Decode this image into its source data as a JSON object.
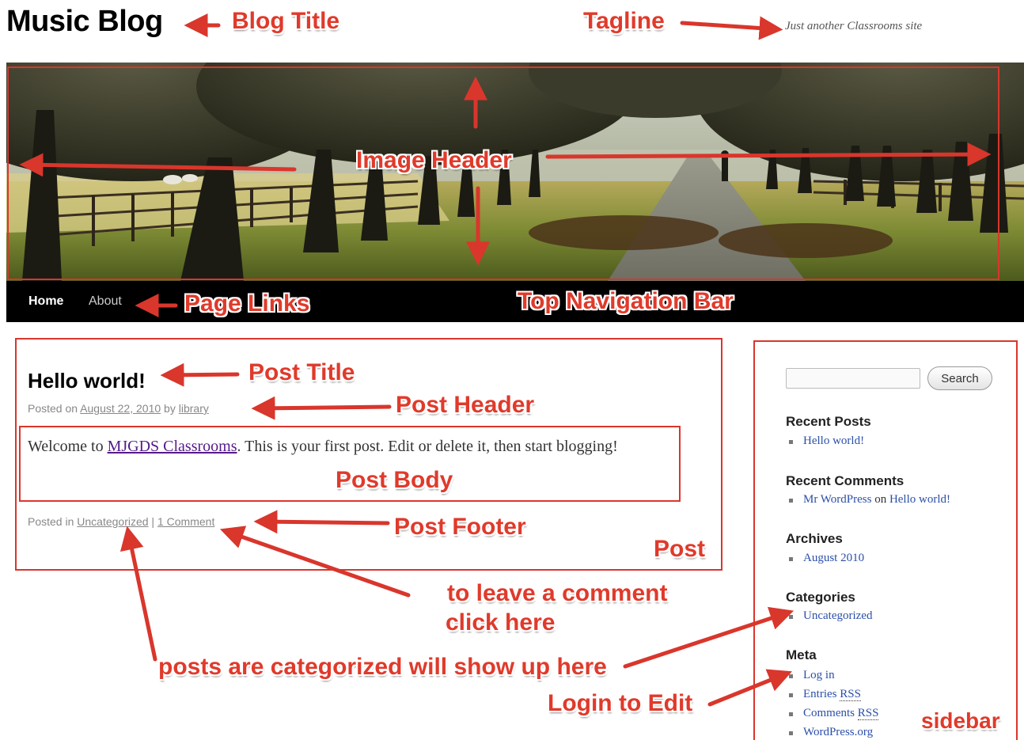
{
  "site": {
    "title": "Music Blog",
    "tagline": "Just another Classrooms site"
  },
  "nav": {
    "items": [
      {
        "label": "Home"
      },
      {
        "label": "About"
      }
    ]
  },
  "post": {
    "title": "Hello world!",
    "meta_prefix": "Posted on ",
    "date": "August 22, 2010",
    "meta_by": " by ",
    "author": "library",
    "body_prefix": "Welcome to ",
    "body_link": "MJGDS Classrooms",
    "body_suffix": ". This is your first post. Edit or delete it, then start blogging!",
    "footer_prefix": "Posted in ",
    "category": "Uncategorized",
    "footer_sep": " | ",
    "comments_link": "1 Comment"
  },
  "sidebar": {
    "search_placeholder": "",
    "search_button": "Search",
    "widgets": {
      "recent_posts": {
        "title": "Recent Posts",
        "items": [
          "Hello world!"
        ]
      },
      "recent_comments": {
        "title": "Recent Comments",
        "author": "Mr WordPress",
        "on": " on ",
        "post": "Hello world!"
      },
      "archives": {
        "title": "Archives",
        "items": [
          "August 2010"
        ]
      },
      "categories": {
        "title": "Categories",
        "items": [
          "Uncategorized"
        ]
      },
      "meta": {
        "title": "Meta",
        "login": "Log in",
        "entries_prefix": "Entries ",
        "comments_prefix": "Comments ",
        "rss": "RSS",
        "wordpress": "WordPress.org"
      }
    }
  },
  "annotations": {
    "blog_title": "Blog Title",
    "tagline": "Tagline",
    "image_header": "Image Header",
    "page_links": "Page Links",
    "top_nav_bar": "Top Navigation Bar",
    "post_title": "Post Title",
    "post_header": "Post Header",
    "post_body": "Post Body",
    "post_footer": "Post Footer",
    "post": "Post",
    "comment_line1": "to leave a comment",
    "comment_line2": "click here",
    "categorized": "posts are categorized will show up here",
    "login": "Login to Edit",
    "sidebar": "sidebar"
  },
  "colors": {
    "annotation": "#e03a2b",
    "nav_background": "#000000",
    "link": "#2b4fa8"
  }
}
